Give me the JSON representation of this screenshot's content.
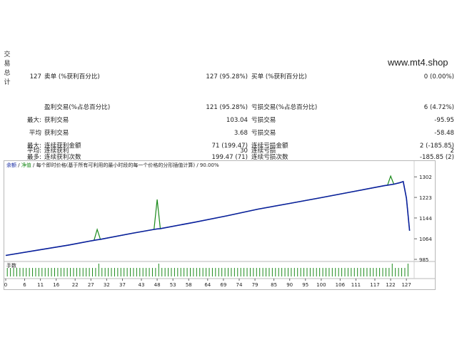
{
  "side_tab": {
    "chars": [
      "交",
      "易",
      "总",
      "计"
    ]
  },
  "watermark": "www.mt4.shop",
  "stats": {
    "row1": {
      "c1": "127",
      "c2": "卖单 (%获利百分比)",
      "c3": "127 (95.28%)",
      "c4": "买单 (%获利百分比)",
      "c5": "0 (0.00%)"
    },
    "row2": {
      "c2": "盈利交易(%占总百分比)",
      "c3": "121 (95.28%)",
      "c4": "亏损交易(%占总百分比)",
      "c5": "6 (4.72%)"
    },
    "row3": {
      "c1": "最大:",
      "c2": "获利交易",
      "c3": "103.04",
      "c4": "亏损交易",
      "c5": "-95.95"
    },
    "row4": {
      "c1": "平均",
      "c2": "获利交易",
      "c3": "3.68",
      "c4": "亏损交易",
      "c5": "-58.48"
    },
    "row5": {
      "c1": "最大:",
      "c2": "连续获利金额",
      "c3": "71 (199.47)",
      "c4": "连续亏损金额",
      "c5": "2 (-185.85)"
    },
    "row6": {
      "c1": "最多:",
      "c2": "连续获利次数",
      "c3": "199.47 (71)",
      "c4": "连续亏损次数",
      "c5": "-185.85 (2)"
    },
    "row7": {
      "c1": "平均:",
      "c2": "连续获利",
      "c3": "30",
      "c4": "连续亏损",
      "c5": "2"
    }
  },
  "chart_header": {
    "balance": "余额",
    "sep1": " / ",
    "equity": "净值",
    "sep2": " / ",
    "desc": "每个即时价格(基于所有可利用的最小时段的每一个价格的分形插值计算)",
    "sep3": " / ",
    "quality": "90.00%"
  },
  "volume_label": "手数",
  "colors": {
    "balance": "#0a1f9e",
    "equity": "#1a8a1a",
    "volume": "#1a8a1a"
  },
  "chart_data": {
    "type": "line",
    "x_ticks": [
      0,
      6,
      11,
      16,
      22,
      27,
      32,
      37,
      43,
      48,
      53,
      58,
      64,
      69,
      74,
      79,
      85,
      90,
      95,
      100,
      106,
      111,
      117,
      122,
      127
    ],
    "y_ticks": [
      985,
      1064,
      1144,
      1223,
      1302
    ],
    "ylim": [
      985,
      1330
    ],
    "xlim": [
      0,
      129
    ],
    "series": [
      {
        "name": "余额",
        "x": [
          0,
          10,
          20,
          28,
          29,
          30,
          40,
          47,
          48,
          49,
          60,
          70,
          80,
          90,
          100,
          110,
          120,
          121,
          122,
          123,
          125,
          126,
          127,
          128
        ],
        "y": [
          1000,
          1020,
          1040,
          1058,
          1060,
          1062,
          1085,
          1100,
          1102,
          1103,
          1128,
          1152,
          1178,
          1200,
          1222,
          1245,
          1268,
          1270,
          1272,
          1274,
          1280,
          1284,
          1220,
          1095
        ]
      },
      {
        "name": "净值",
        "x": [
          0,
          10,
          20,
          28,
          29,
          30,
          40,
          47,
          48,
          49,
          60,
          70,
          80,
          90,
          100,
          110,
          120,
          121,
          122,
          123,
          125,
          126,
          127,
          128
        ],
        "y": [
          1000,
          1020,
          1040,
          1058,
          1100,
          1062,
          1085,
          1100,
          1215,
          1103,
          1128,
          1152,
          1178,
          1200,
          1222,
          1245,
          1268,
          1270,
          1305,
          1274,
          1280,
          1284,
          1220,
          1095
        ]
      }
    ],
    "volume_spikes_at": [
      29,
      48,
      122,
      127
    ]
  }
}
